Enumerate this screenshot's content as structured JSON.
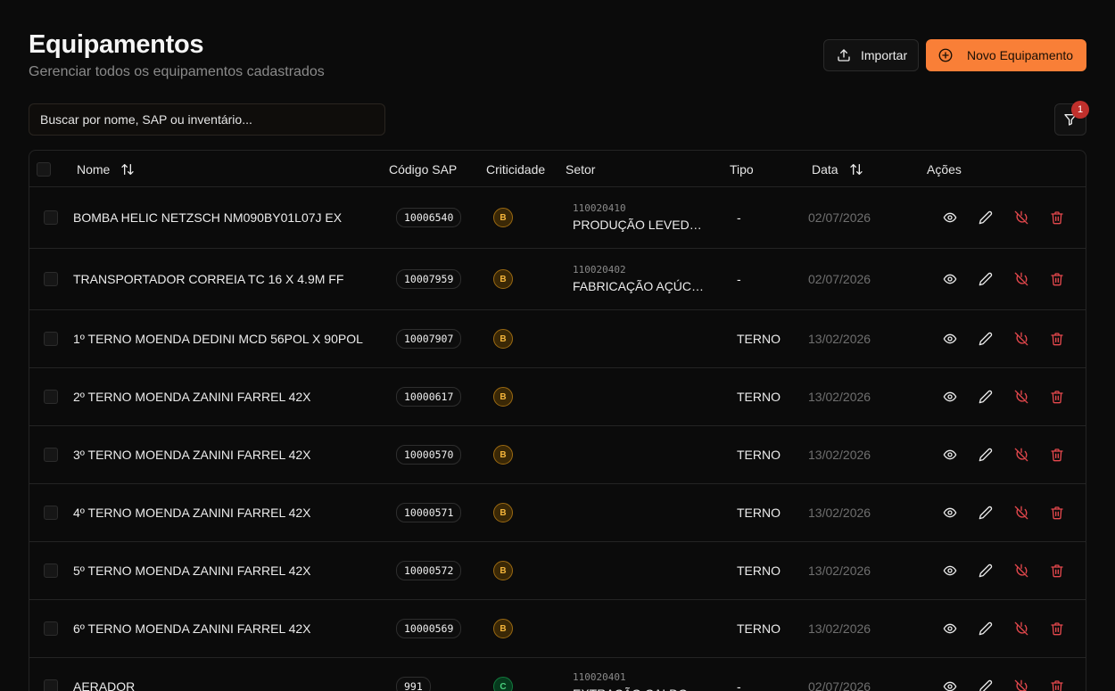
{
  "header": {
    "title": "Equipamentos",
    "subtitle": "Gerenciar todos os equipamentos cadastrados"
  },
  "toolbar": {
    "import_label": "Importar",
    "new_label": "Novo Equipamento"
  },
  "search": {
    "placeholder": "Buscar por nome, SAP ou inventário..."
  },
  "filter": {
    "badge_count": "1"
  },
  "colors": {
    "accent": "#f97f37",
    "badge": "#c0302c",
    "crit_b": "#f3b43b",
    "crit_c": "#4ad17e",
    "danger": "#e5484d"
  },
  "table": {
    "columns": {
      "nome": "Nome",
      "sap": "Código SAP",
      "criticidade": "Criticidade",
      "setor": "Setor",
      "tipo": "Tipo",
      "data": "Data",
      "acoes": "Ações"
    },
    "rows": [
      {
        "nome": "BOMBA HELIC NETZSCH NM090BY01L07J EX",
        "sap": "10006540",
        "crit": "B",
        "setor_code": "110020410",
        "setor_name": "PRODUÇÃO LEVEDU...",
        "tipo": "-",
        "data": "02/07/2026"
      },
      {
        "nome": "TRANSPORTADOR CORREIA TC 16 X 4.9M FF",
        "sap": "10007959",
        "crit": "B",
        "setor_code": "110020402",
        "setor_name": "FABRICAÇÃO AÇÚCAR",
        "tipo": "-",
        "data": "02/07/2026"
      },
      {
        "nome": "1º TERNO MOENDA DEDINI MCD 56POL X 90POL",
        "sap": "10007907",
        "crit": "B",
        "setor_code": "",
        "setor_name": "",
        "tipo": "TERNO",
        "data": "13/02/2026"
      },
      {
        "nome": "2º TERNO MOENDA ZANINI FARREL 42X",
        "sap": "10000617",
        "crit": "B",
        "setor_code": "",
        "setor_name": "",
        "tipo": "TERNO",
        "data": "13/02/2026"
      },
      {
        "nome": "3º TERNO MOENDA ZANINI FARREL 42X",
        "sap": "10000570",
        "crit": "B",
        "setor_code": "",
        "setor_name": "",
        "tipo": "TERNO",
        "data": "13/02/2026"
      },
      {
        "nome": "4º TERNO MOENDA ZANINI FARREL 42X",
        "sap": "10000571",
        "crit": "B",
        "setor_code": "",
        "setor_name": "",
        "tipo": "TERNO",
        "data": "13/02/2026"
      },
      {
        "nome": "5º TERNO MOENDA ZANINI FARREL 42X",
        "sap": "10000572",
        "crit": "B",
        "setor_code": "",
        "setor_name": "",
        "tipo": "TERNO",
        "data": "13/02/2026"
      },
      {
        "nome": "6º TERNO MOENDA ZANINI FARREL 42X",
        "sap": "10000569",
        "crit": "B",
        "setor_code": "",
        "setor_name": "",
        "tipo": "TERNO",
        "data": "13/02/2026"
      },
      {
        "nome": "AERADOR",
        "sap": "991",
        "crit": "C",
        "setor_code": "110020401",
        "setor_name": "EXTRAÇÃO CALDO",
        "tipo": "-",
        "data": "02/07/2026"
      }
    ],
    "action_icons": [
      "eye-icon",
      "pencil-icon",
      "power-off-icon",
      "trash-icon"
    ]
  }
}
